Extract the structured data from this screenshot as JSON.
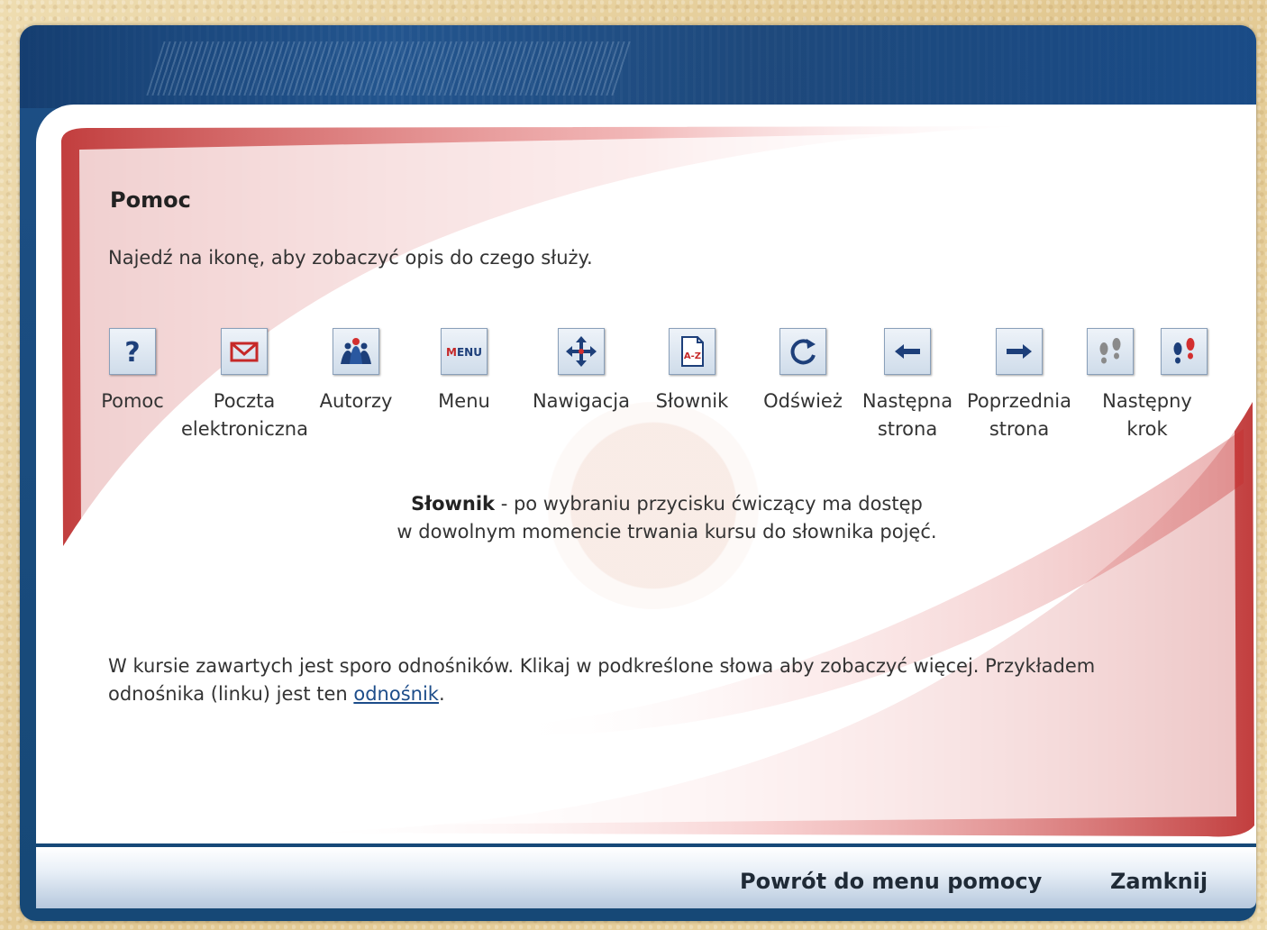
{
  "title": "Pomoc",
  "intro": "Najedź na ikonę, aby zobaczyć opis do czego służy.",
  "icons": [
    {
      "label": "Pomoc",
      "icon": "question-icon"
    },
    {
      "label": "Poczta\nelektroniczna",
      "icon": "mail-icon"
    },
    {
      "label": "Autorzy",
      "icon": "people-icon"
    },
    {
      "label": "Menu",
      "icon": "menu-icon"
    },
    {
      "label": "Nawigacja",
      "icon": "move-arrows-icon"
    },
    {
      "label": "Słownik",
      "icon": "dictionary-az-icon"
    },
    {
      "label": "Odśwież",
      "icon": "refresh-icon"
    },
    {
      "label": "Następna\nstrona",
      "icon": "arrow-left-icon"
    },
    {
      "label": "Poprzednia\nstrona",
      "icon": "arrow-right-icon"
    },
    {
      "label": "Następny\nkrok",
      "icon": "footsteps-icon"
    }
  ],
  "description": {
    "term": "Słownik",
    "line1": " - po wybraniu przycisku ćwiczący ma dostęp",
    "line2": "w dowolnym momencie trwania kursu do słownika pojęć."
  },
  "links_info": {
    "text": "W kursie zawartych jest sporo odnośników. Klikaj w podkreślone słowa aby zobaczyć więcej. Przykładem odnośnika (linku) jest ten ",
    "link": "odnośnik",
    "suffix": "."
  },
  "footer": {
    "back": "Powrót do menu pomocy",
    "close": "Zamknij"
  },
  "colors": {
    "frame": "#1d4f85",
    "accent_red": "#c0282a",
    "link": "#1d4d8a"
  }
}
